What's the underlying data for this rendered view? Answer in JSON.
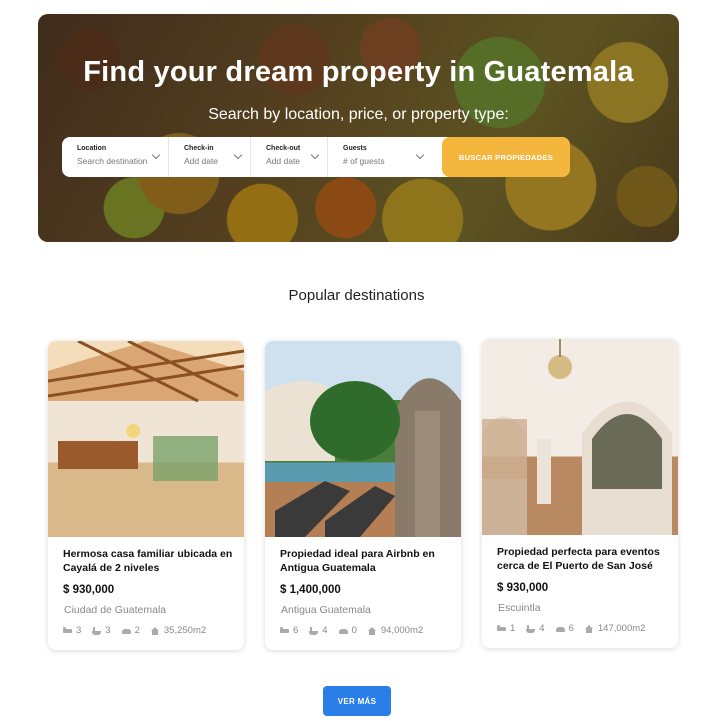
{
  "hero": {
    "title": "Find your dream property in Guatemala",
    "subtitle": "Search by location, price, or property type:"
  },
  "search": {
    "fields": [
      {
        "label": "Location",
        "value": "Search destination"
      },
      {
        "label": "Check-in",
        "value": "Add date"
      },
      {
        "label": "Check-out",
        "value": "Add date"
      },
      {
        "label": "Guests",
        "value": "# of guests"
      }
    ],
    "button_label": "BUSCAR PROPIEDADES"
  },
  "section_title": "Popular destinations",
  "cards": [
    {
      "title": "Hermosa casa familiar ubicada en Cayalá de 2 niveles",
      "price": "$ 930,000",
      "location": "Ciudad de Guatemala",
      "beds": "3",
      "baths": "3",
      "parking": "2",
      "area": "35,250m2"
    },
    {
      "title": "Propiedad ideal para Airbnb en Antigua Guatemala",
      "price": "$ 1,400,000",
      "location": "Antigua Guatemala",
      "beds": "6",
      "baths": "4",
      "parking": "0",
      "area": "94,000m2"
    },
    {
      "title": "Propiedad perfecta para eventos cerca de El Puerto de San José",
      "price": "$ 930,000",
      "location": "Escuintla",
      "beds": "1",
      "baths": "4",
      "parking": "6",
      "area": "147,000m2"
    }
  ],
  "more_button": "VER MÁS",
  "colors": {
    "accent": "#f5b63e",
    "primary": "#2a7ee8"
  }
}
